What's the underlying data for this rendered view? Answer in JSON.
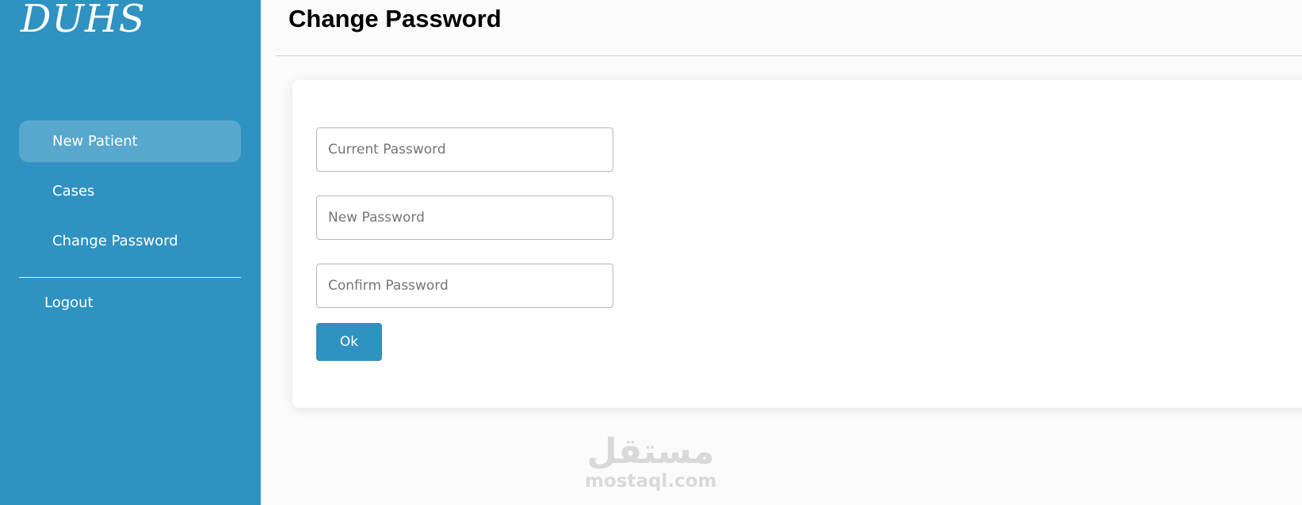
{
  "brand": "DUHS",
  "sidebar": {
    "items": [
      {
        "label": "New Patient",
        "active": true
      },
      {
        "label": "Cases",
        "active": false
      },
      {
        "label": "Change Password",
        "active": false
      }
    ],
    "logout_label": "Logout"
  },
  "main": {
    "title": "Change Password",
    "form": {
      "current_password": {
        "placeholder": "Current Password",
        "value": ""
      },
      "new_password": {
        "placeholder": "New Password",
        "value": ""
      },
      "confirm_password": {
        "placeholder": "Confirm Password",
        "value": ""
      },
      "ok_label": "Ok"
    }
  },
  "watermark": {
    "arabic": "مستقل",
    "latin": "mostaql.com"
  },
  "colors": {
    "sidebar_bg": "#2f92c1",
    "accent": "#2f92c1",
    "page_bg": "#fbfbfb"
  }
}
